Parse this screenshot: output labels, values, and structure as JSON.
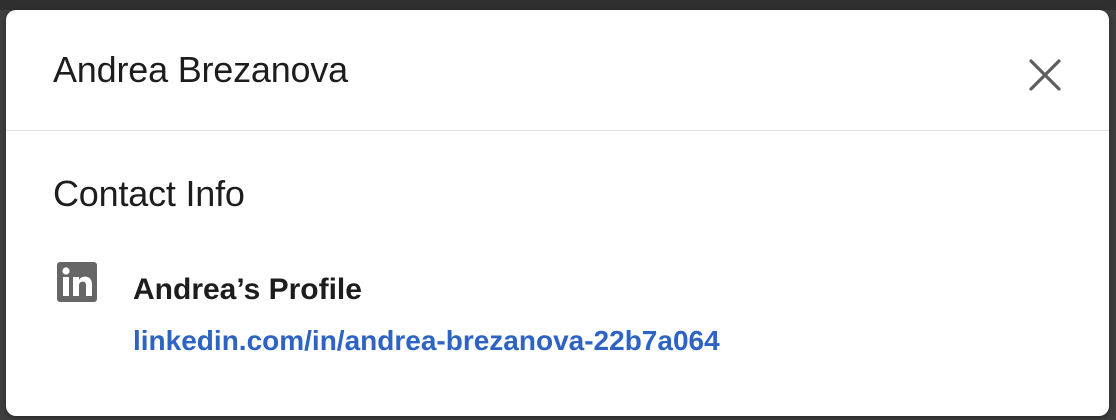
{
  "modal": {
    "title": "Andrea Brezanova",
    "close_icon": "close-icon",
    "section_title": "Contact Info",
    "contact": {
      "icon": "linkedin-icon",
      "label": "Andrea’s Profile",
      "link_text": "linkedin.com/in/andrea-brezanova-22b7a064"
    }
  },
  "colors": {
    "link": "#2c63c5",
    "text": "#1d1d1d",
    "icon": "#666666"
  }
}
